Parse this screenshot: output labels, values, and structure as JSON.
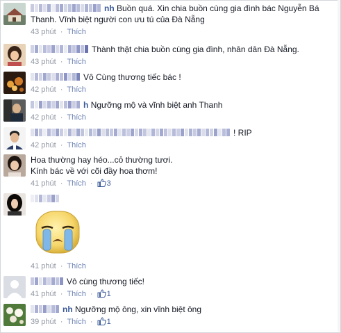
{
  "colors": {
    "link": "#3b5998",
    "meta": "#9197a3",
    "like": "#6d84b4",
    "border": "#d3d6db"
  },
  "comments": [
    {
      "author_suffix": "nh",
      "text_line1": "Buồn quá. Xin chia buồn cùng gia đình bác Nguyễn Bá",
      "text_line2": "Thanh. Vĩnh biệt người con ưu tú của Đà Nẵng",
      "time": "43 phút",
      "like_label": "Thích",
      "avatar_icon": "house-photo-icon"
    },
    {
      "author_suffix": "",
      "text_line1": "Thành thật chia buồn cùng gia đình, nhân dân Đà Nẵng.",
      "time": "43 phút",
      "like_label": "Thích",
      "avatar_icon": "woman-photo-icon"
    },
    {
      "author_suffix": "",
      "text_line1": "Vô Cùng thương tiếc bác !",
      "time": "42 phút",
      "like_label": "Thích",
      "avatar_icon": "candle-photo-icon"
    },
    {
      "author_suffix": "h",
      "text_line1": "Ngưỡng mộ và vĩnh biệt anh Thanh",
      "time": "42 phút",
      "like_label": "Thích",
      "avatar_icon": "man-photo-icon"
    },
    {
      "author_suffix": "",
      "text_line1": "! RIP",
      "time": "42 phút",
      "like_label": "Thích",
      "avatar_icon": "man-portrait-icon"
    },
    {
      "author_suffix": "",
      "text_line1": "Hoa thường hay héo...cỏ thường tươi.",
      "text_line2": "Kính bác về với cõi đầy hoa thơm!",
      "time": "41 phút",
      "like_label": "Thích",
      "likes": "3",
      "avatar_icon": "girl-photo-icon"
    },
    {
      "author_suffix": "",
      "time": "41 phút",
      "like_label": "Thích",
      "avatar_icon": "woman-dark-photo-icon",
      "sticker": "crying-face-sticker"
    },
    {
      "author_suffix": "",
      "text_line1": "Vô cùng thương tiếc!",
      "time": "41 phút",
      "like_label": "Thích",
      "likes": "1",
      "avatar_icon": "default-avatar-icon"
    },
    {
      "author_suffix": "nh",
      "text_line1": "Ngưỡng mộ ông, xin vĩnh biệt ông",
      "time": "39 phút",
      "like_label": "Thích",
      "likes": "1",
      "avatar_icon": "flower-photo-icon"
    }
  ]
}
